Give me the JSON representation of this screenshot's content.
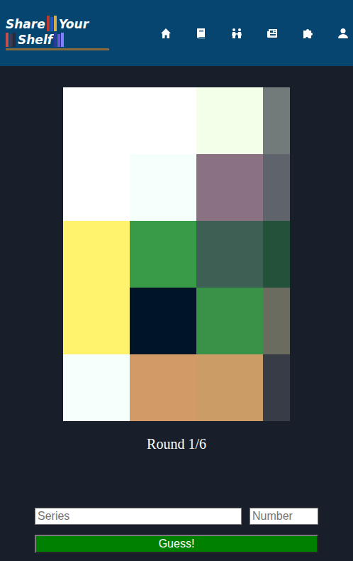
{
  "logo": {
    "words": [
      "Share",
      "Your",
      "Shelf"
    ]
  },
  "cover": {
    "cells": [
      [
        {
          "color": "#ffffff"
        },
        {
          "color": "#ffffff"
        },
        {
          "color": "#f4ffea"
        },
        {
          "color": "#737a7a"
        }
      ],
      [
        {
          "color": "#ffffff"
        },
        {
          "color": "#f5fffc"
        },
        {
          "color": "#8a7282"
        },
        {
          "color": "#5f646c"
        }
      ],
      [
        {
          "color": "#fff36d"
        },
        {
          "color": "#399a47"
        },
        {
          "color": "#3e5f54"
        },
        {
          "color": "#23513a"
        }
      ],
      [
        {
          "color": "#fff36d"
        },
        {
          "color": "#001428"
        },
        {
          "color": "#399247"
        },
        {
          "color": "#6b6c60"
        }
      ],
      [
        {
          "color": "#f7fffd"
        },
        {
          "color": "#d29a67"
        },
        {
          "color": "#cc9c66"
        },
        {
          "color": "#373c47"
        }
      ]
    ]
  },
  "round": "Round 1/6",
  "form": {
    "series": {
      "placeholder": "Series"
    },
    "number": {
      "placeholder": "Number"
    },
    "button": "Guess!"
  }
}
